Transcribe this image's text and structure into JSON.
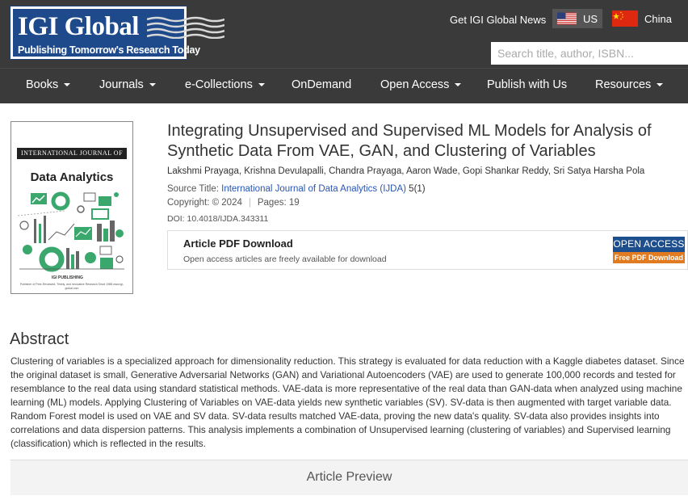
{
  "header": {
    "logo": {
      "title": "IGI Global",
      "tagline": "Publishing Tomorrow's Research Today"
    },
    "news_link": "Get IGI Global News",
    "regions": [
      {
        "label": "US"
      },
      {
        "label": "China"
      }
    ],
    "search": {
      "placeholder": "Search title, author, ISBN..."
    }
  },
  "nav": {
    "items": [
      {
        "label": "Books",
        "dropdown": true
      },
      {
        "label": "Journals",
        "dropdown": true
      },
      {
        "label": "e-Collections",
        "dropdown": true
      },
      {
        "label": "OnDemand",
        "dropdown": false
      },
      {
        "label": "Open Access",
        "dropdown": true
      },
      {
        "label": "Publish with Us",
        "dropdown": false
      },
      {
        "label": "Resources",
        "dropdown": true
      }
    ]
  },
  "cover": {
    "band": "INTERNATIONAL JOURNAL OF",
    "title": "Data Analytics",
    "publisher": "IGI PUBLISHING",
    "footer": "Publisher of Peer-Reviewed, Timely, and Innovative Research Since 1988 www.igi-global.com"
  },
  "article": {
    "title": "Integrating Unsupervised and Supervised ML Models for Analysis of Synthetic Data From VAE, GAN, and Clustering of Variables",
    "authors": "Lakshmi Prayaga, Krishna Devulapalli, Chandra Prayaga, Aaron Wade, Gopi Shankar Reddy, Sri Satya Harsha Pola",
    "source_label": "Source Title:",
    "source_title": "International Journal of Data Analytics (IJDA)",
    "volume_issue": "5(1)",
    "copyright": "Copyright: © 2024",
    "pages": "Pages: 19",
    "doi": "DOI: 10.4018/IJDA.343311"
  },
  "pdf": {
    "title": "Article PDF Download",
    "subtitle": "Open access articles are freely available for download",
    "button_top": "OPEN ACCESS",
    "button_bottom": "Free PDF Download"
  },
  "abstract": {
    "heading": "Abstract",
    "text": "Clustering of variables is a specialized approach for dimensionality reduction. This strategy is evaluated for data reduction with a Kaggle diabetes dataset. Since the original dataset is small, Generative Adversarial Networks (GAN) and Variational Autoencoders (VAE) are used to generate 100,000 records and tested for resemblance to the real data using standard statistical methods. VAE-data is more representative of the real data than GAN-data when analyzed using machine learning (ML) models. Applying Clustering of Variables on VAE-data yields new synthetic variables (SV). SV-data is then augmented with target variable data. Random Forest model is used on VAE and SV data. SV-data results matched VAE-data, proving the new data's quality. SV-data also provides insights into correlations and data dispersion patterns. This analysis implements a combination of Unsupervised learning (clustering of variables) and Supervised learning (classification) which is reflected in the results."
  },
  "preview": {
    "label": "Article Preview"
  },
  "colors": {
    "header_bg": "#3a3a3a",
    "logo_blue": "#1e4a8c",
    "link_blue": "#2a55b3",
    "oa_blue": "#1d4f8f",
    "oa_orange": "#e07b22"
  }
}
